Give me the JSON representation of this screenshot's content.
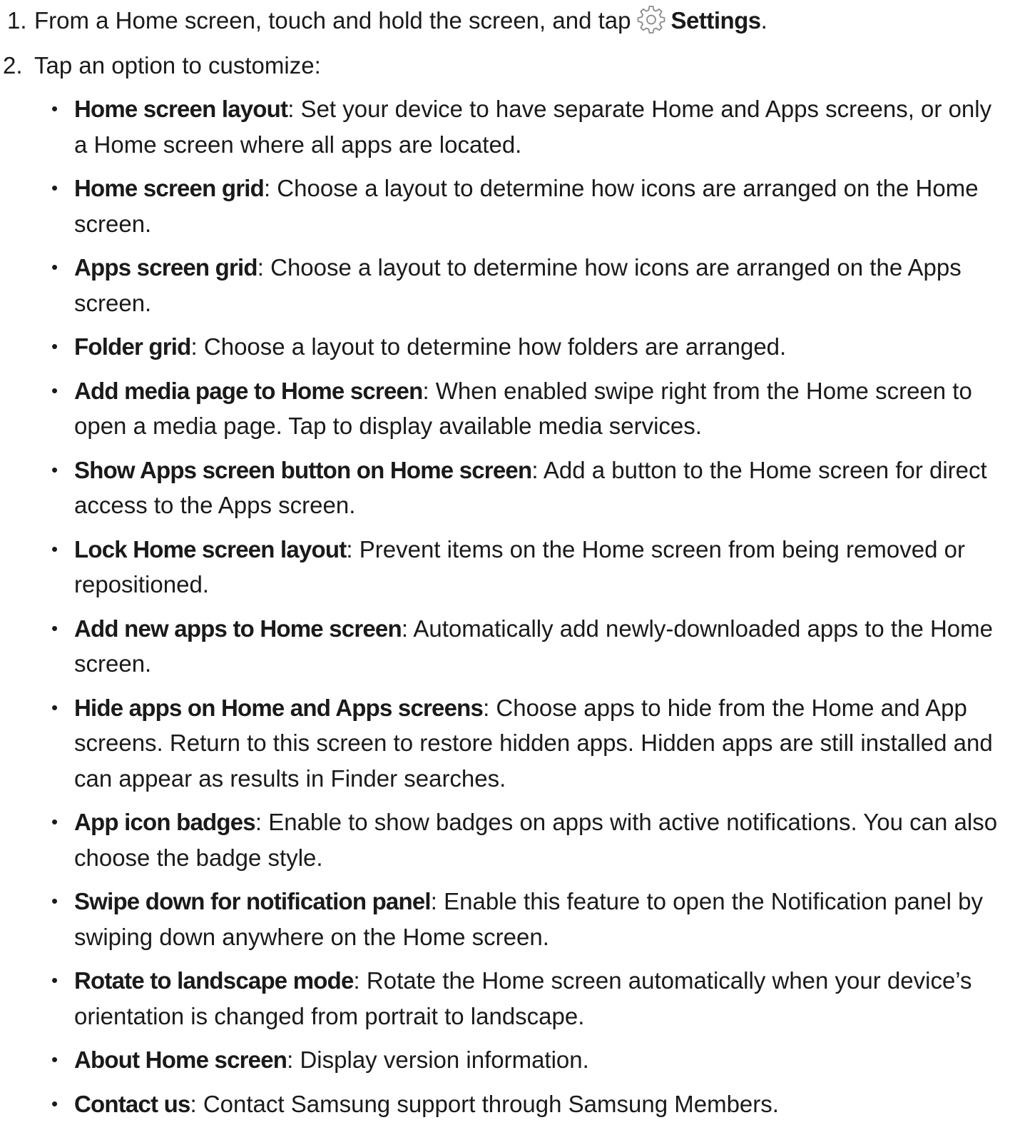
{
  "steps": [
    {
      "number": "1.",
      "text_before": "From a Home screen, touch and hold the screen, and tap",
      "icon": "gear-icon",
      "bold": "Settings",
      "text_after": "."
    },
    {
      "number": "2.",
      "text": "Tap an option to customize:"
    }
  ],
  "options": [
    {
      "term": "Home screen layout",
      "desc": ": Set your device to have separate Home and Apps screens, or only a Home screen where all apps are located."
    },
    {
      "term": "Home screen grid",
      "desc": ": Choose a layout to determine how icons are arranged on the Home screen."
    },
    {
      "term": "Apps screen grid",
      "desc": ": Choose a layout to determine how icons are arranged on the Apps screen."
    },
    {
      "term": "Folder grid",
      "desc": ": Choose a layout to determine how folders are arranged."
    },
    {
      "term": "Add media page to Home screen",
      "desc": ": When enabled swipe right from the Home screen to open a media page. Tap to display available media services."
    },
    {
      "term": "Show Apps screen button on Home screen",
      "desc": ": Add a button to the Home screen for direct access to the Apps screen."
    },
    {
      "term": "Lock Home screen layout",
      "desc": ": Prevent items on the Home screen from being removed or repositioned."
    },
    {
      "term": "Add new apps to Home screen",
      "desc": ": Automatically add newly-downloaded apps to the Home screen."
    },
    {
      "term": "Hide apps on Home and Apps screens",
      "desc": ": Choose apps to hide from the Home and App screens. Return to this screen to restore hidden apps. Hidden apps are still installed and can appear as results in Finder searches."
    },
    {
      "term": "App icon badges",
      "desc": ": Enable to show badges on apps with active notifications. You can also choose the badge style."
    },
    {
      "term": "Swipe down for notification panel",
      "desc": ": Enable this feature to open the Notification panel by swiping down anywhere on the Home screen."
    },
    {
      "term": "Rotate to landscape mode",
      "desc": ": Rotate the Home screen automatically when your device’s orientation is changed from portrait to landscape."
    },
    {
      "term": "About Home screen",
      "desc": ": Display version information."
    },
    {
      "term": "Contact us",
      "desc": ": Contact Samsung support through Samsung Members."
    }
  ],
  "colors": {
    "text": "#1a1a1a",
    "icon_stroke": "#8a8a8a"
  }
}
